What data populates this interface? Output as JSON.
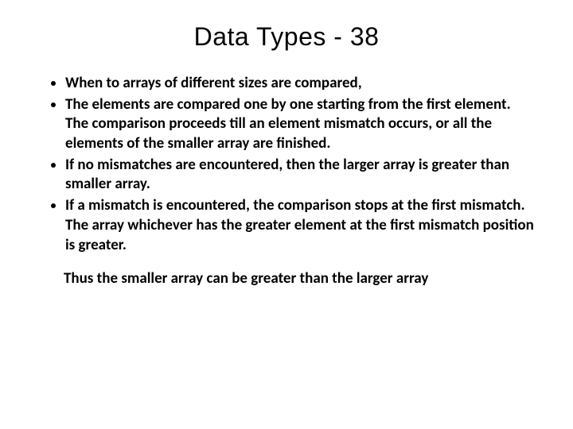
{
  "slide": {
    "title": "Data Types - 38",
    "bullets": [
      "When to arrays of different sizes are compared,",
      "The elements are compared one by one starting from the first element.\nThe comparison proceeds till an element mismatch occurs, or all the elements of the smaller array are finished.",
      "If no mismatches are encountered, then the larger array is greater than smaller array.",
      "If a mismatch is encountered, the comparison stops at the first mismatch. The array whichever has the greater element at the first mismatch position is greater."
    ],
    "followup": "Thus the smaller array can be greater than the larger array"
  }
}
